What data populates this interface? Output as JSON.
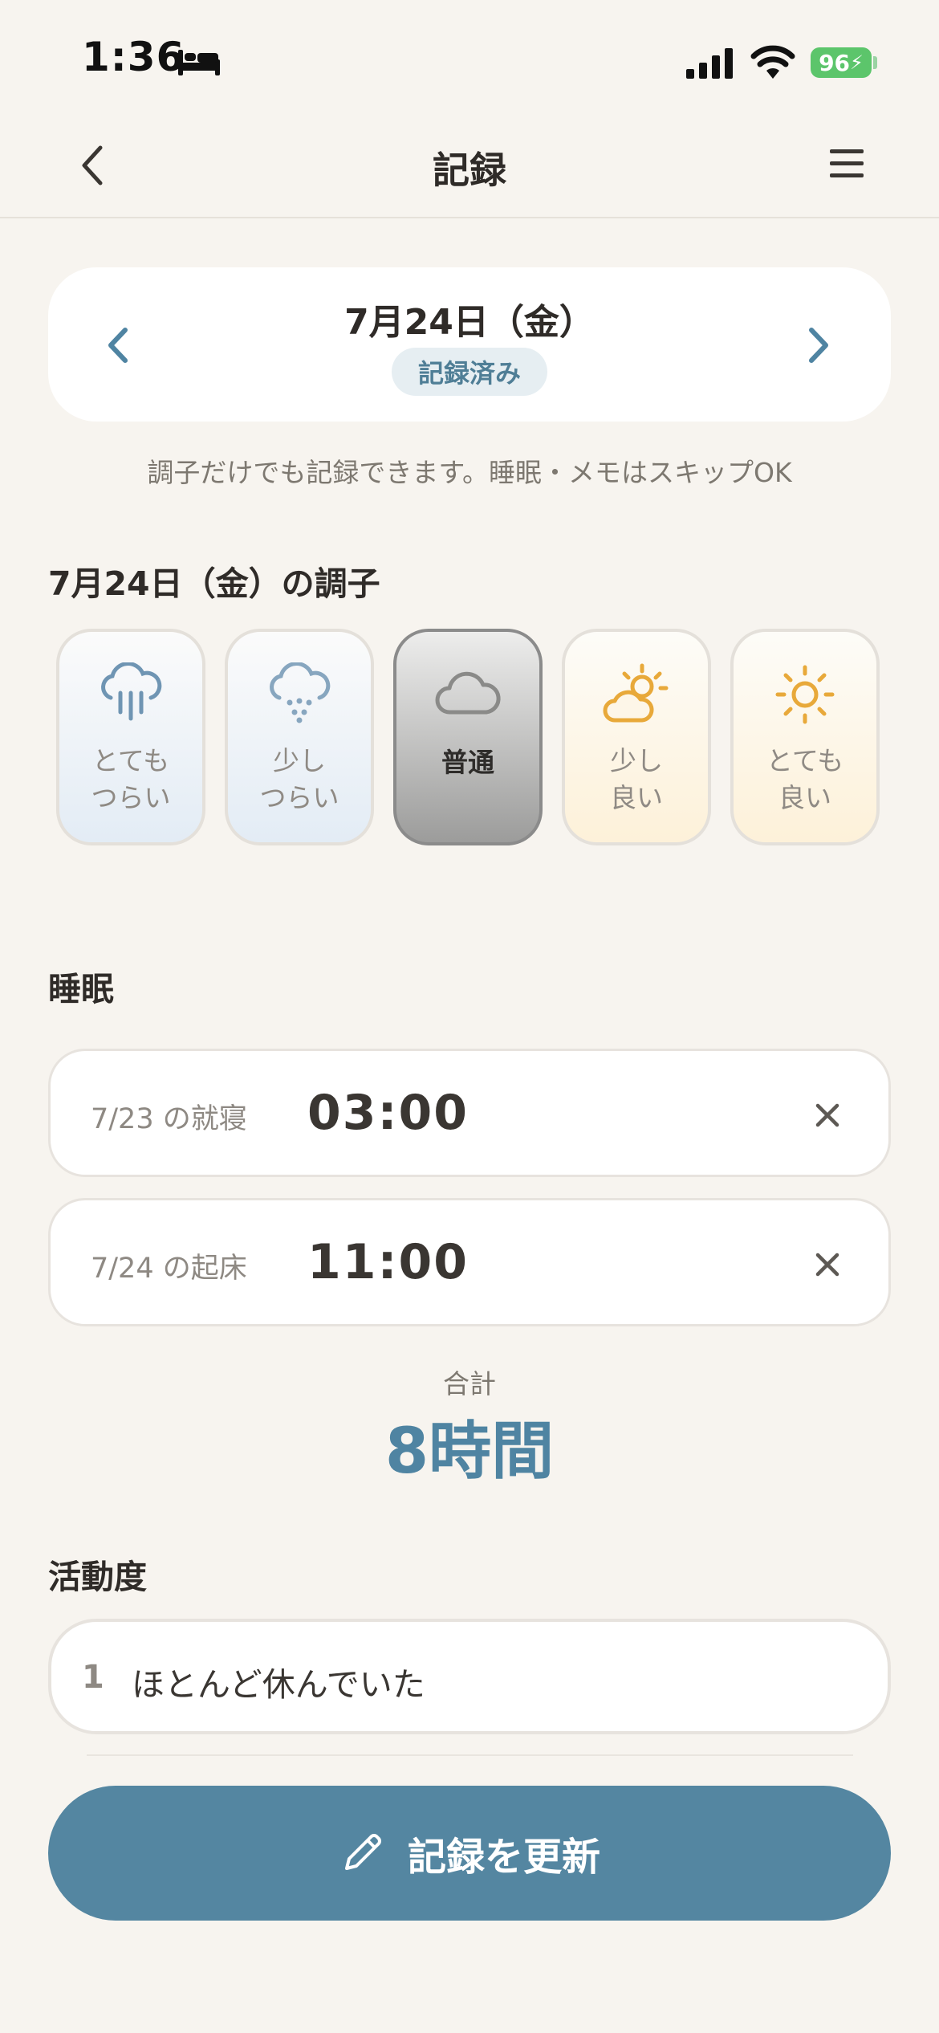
{
  "status_bar": {
    "time": "1:36",
    "battery": "96"
  },
  "nav": {
    "title": "記録"
  },
  "date_card": {
    "date": "7月24日（金）",
    "badge": "記録済み"
  },
  "hint": "調子だけでも記録できます。睡眠・メモはスキップOK",
  "mood_section": {
    "title": "7月24日（金）の調子",
    "options": [
      {
        "line1": "とても",
        "line2": "つらい",
        "icon": "heavy-rain-icon"
      },
      {
        "line1": "少し",
        "line2": "つらい",
        "icon": "light-rain-icon"
      },
      {
        "line1": "普通",
        "line2": "",
        "icon": "cloud-icon"
      },
      {
        "line1": "少し",
        "line2": "良い",
        "icon": "partly-sunny-icon"
      },
      {
        "line1": "とても",
        "line2": "良い",
        "icon": "sun-icon"
      }
    ],
    "selected": "普通"
  },
  "sleep": {
    "title": "睡眠",
    "bedtime": {
      "label": "7/23 の就寝",
      "time": "03:00"
    },
    "wake": {
      "label": "7/24 の起床",
      "time": "11:00"
    },
    "total_label": "合計",
    "total_value": "8時間"
  },
  "activity": {
    "title": "活動度",
    "number": "1",
    "text": "ほとんど休んでいた"
  },
  "update_button": {
    "label": "記録を更新"
  },
  "colors": {
    "accent": "#5486a1",
    "background": "#f7f4ef",
    "rain": "#6f95b3",
    "sun": "#e8a93a"
  }
}
